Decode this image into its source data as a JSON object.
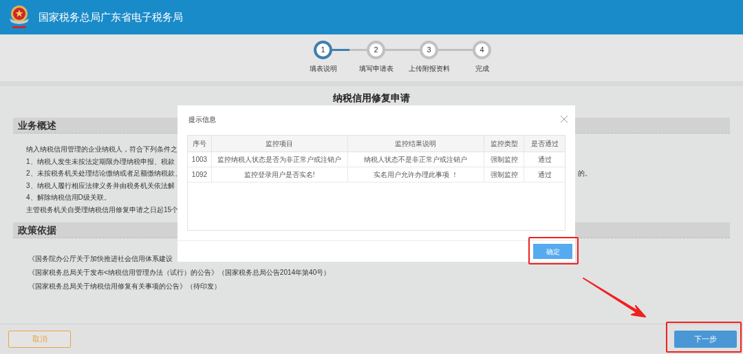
{
  "header": {
    "title": "国家税务总局广东省电子税务局"
  },
  "steps": [
    {
      "number": "1",
      "label": "填表说明",
      "selected": true
    },
    {
      "number": "2",
      "label": "填写申请表",
      "selected": false
    },
    {
      "number": "3",
      "label": "上传附报资料",
      "selected": false
    },
    {
      "number": "4",
      "label": "完成",
      "selected": false
    }
  ],
  "page_title": "纳税信用修复申请",
  "sections": [
    {
      "heading": "业务概述",
      "kind": "overview",
      "lines": [
        {
          "text": "纳入纳税信用管理的企业纳税人，符合下列条件之"
        },
        {
          "text": "1、纳税人发生未按法定期限办理纳税申报、税款"
        },
        {
          "text": "2、未按税务机关处理结论缴纳或者足额缴纳税款、",
          "tail": "的。"
        },
        {
          "text": "3、纳税人履行相应法律义务并由税务机关依法解"
        },
        {
          "text": "4、解除纳税信用D级关联。"
        },
        {
          "text": "主管税务机关自受理纳税信用修复申请之日起15个"
        }
      ]
    },
    {
      "heading": "政策依据",
      "kind": "policy",
      "lines": [
        {
          "text": "《国务院办公厅关于加快推进社会信用体系建设"
        },
        {
          "text": "《国家税务总局关于发布<纳税信用管理办法（试行）的公告》（国家税务总局公告2014年第40号）"
        },
        {
          "text": "《国家税务总局关于纳税信用修复有关事项的公告》（待印发）"
        }
      ]
    }
  ],
  "dialog": {
    "title": "提示信息",
    "columns": [
      "序号",
      "监控项目",
      "监控结果说明",
      "监控类型",
      "是否通过"
    ],
    "rows": [
      [
        "1003",
        "监控纳税人状态是否为非正常户或注销户",
        "纳税人状态不是非正常户或注销户",
        "强制监控",
        "通过"
      ],
      [
        "1092",
        "监控登录用户是否实名!",
        "实名用户允许办理此事项 ！",
        "强制监控",
        "通过"
      ]
    ],
    "confirm_button": "确定"
  },
  "footer": {
    "cancel_button": "取消",
    "next_button": "下一步"
  }
}
